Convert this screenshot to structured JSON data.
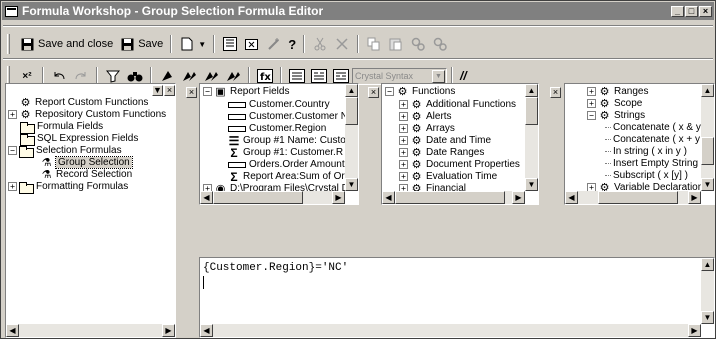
{
  "window": {
    "title": "Formula Workshop - Group Selection Formula Editor",
    "min": "_",
    "max": "□",
    "close": "×"
  },
  "toolbar1": {
    "save_close": "Save and close",
    "save": "Save",
    "help": "?"
  },
  "toolbar2": {
    "syntax": "Crystal Syntax",
    "comment": "//"
  },
  "tree": {
    "items": [
      {
        "label": "Report Custom Functions",
        "expander": "",
        "icon": "gear-cluster"
      },
      {
        "label": "Repository Custom Functions",
        "expander": "+",
        "icon": "gear-cluster"
      },
      {
        "label": "Formula Fields",
        "expander": "",
        "icon": "folder"
      },
      {
        "label": "SQL Expression Fields",
        "expander": "",
        "icon": "folder"
      },
      {
        "label": "Selection Formulas",
        "expander": "−",
        "icon": "folder"
      },
      {
        "label": "Group Selection",
        "expander": "",
        "icon": "filter",
        "selected": true
      },
      {
        "label": "Record Selection",
        "expander": "",
        "icon": "filter"
      },
      {
        "label": "Formatting Formulas",
        "expander": "+",
        "icon": "folder"
      }
    ]
  },
  "fields_pane": {
    "root": "Report Fields",
    "items": [
      {
        "label": "Customer.Country",
        "icon": "db-field"
      },
      {
        "label": "Customer.Customer Na",
        "icon": "db-field"
      },
      {
        "label": "Customer.Region",
        "icon": "db-field"
      },
      {
        "label": "Group #1 Name: Custo",
        "icon": "group-name"
      },
      {
        "label": "Group #1: Customer.R",
        "icon": "sum"
      },
      {
        "label": "Orders.Order Amount",
        "icon": "db-field"
      },
      {
        "label": "Report Area:Sum of Or",
        "icon": "sum"
      },
      {
        "label": "D:\\Program Files\\Crystal D",
        "icon": "database"
      }
    ]
  },
  "functions_pane": {
    "root": "Functions",
    "items": [
      "Additional Functions",
      "Alerts",
      "Arrays",
      "Date and Time",
      "Date Ranges",
      "Document Properties",
      "Evaluation Time",
      "Financial"
    ]
  },
  "operators_pane": {
    "items": [
      {
        "label": "Ranges",
        "level": 0,
        "exp": "+"
      },
      {
        "label": "Scope",
        "level": 0,
        "exp": "+"
      },
      {
        "label": "Strings",
        "level": 0,
        "exp": "−"
      },
      {
        "label": "Concatenate ( x & y )",
        "level": 1
      },
      {
        "label": "Concatenate ( x + y )",
        "level": 1
      },
      {
        "label": "In string ( x in y )",
        "level": 1
      },
      {
        "label": "Insert Empty String ( \"",
        "level": 1
      },
      {
        "label": "Subscript ( x [y] )",
        "level": 1
      },
      {
        "label": "Variable Declarations",
        "level": 0,
        "exp": "+"
      }
    ]
  },
  "editor": {
    "code": "{Customer.Region}='NC'"
  }
}
